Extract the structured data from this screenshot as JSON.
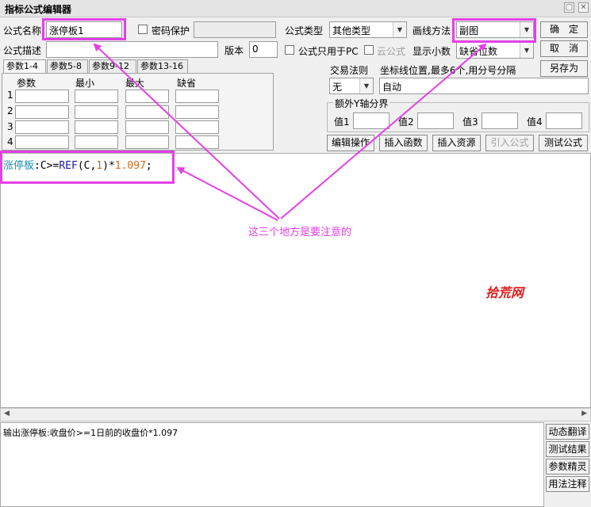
{
  "window": {
    "title": "指标公式编辑器",
    "restore_glyph": "□",
    "close_glyph": "✕"
  },
  "form": {
    "name_label": "公式名称",
    "name_value": "涨停板1",
    "password_label": "密码保护",
    "type_label": "公式类型",
    "type_value": "其他类型",
    "draw_label": "画线方法",
    "draw_value": "副图",
    "desc_label": "公式描述",
    "desc_value": "",
    "version_label": "版本",
    "version_value": "0",
    "pc_only_label": "公式只用于PC",
    "cloud_label": "云公式",
    "decimal_label": "显示小数",
    "decimal_value": "缺省位数",
    "trade_rule_label": "交易法则",
    "trade_rule_value": "无",
    "axis_label": "坐标线位置,最多6个,用分号分隔",
    "axis_value": "自动",
    "extra_y_label": "额外Y轴分界",
    "extra_y_values": [
      "值1",
      "值2",
      "值3",
      "值4"
    ]
  },
  "buttons": {
    "ok": "确　定",
    "cancel": "取　消",
    "save_as": "另存为",
    "edit_ops": "编辑操作",
    "insert_func": "插入函数",
    "insert_res": "插入资源",
    "import_formula": "引入公式",
    "test_formula": "测试公式"
  },
  "tabs": [
    "参数1-4",
    "参数5-8",
    "参数9-12",
    "参数13-16"
  ],
  "param_table": {
    "headers": [
      "参数",
      "最小",
      "最大",
      "缺省"
    ],
    "rows": [
      "1",
      "2",
      "3",
      "4"
    ]
  },
  "code": {
    "name": "涨停板",
    "rest": ":C>=REF(C,1)*1.097;"
  },
  "output_text": "输出涨停板:收盘价>=1日前的收盘价*1.097",
  "side_buttons": [
    "动态翻译",
    "测试结果",
    "参数精灵",
    "用法注释"
  ],
  "annotation": {
    "note": "这三个地方是要注意的",
    "watermark": "拾荒网",
    "color": "#e341e6"
  },
  "colors": {
    "code_name": "#1e8fa8",
    "code_ref": "#1a1aa0",
    "code_number": "#d2691e"
  }
}
